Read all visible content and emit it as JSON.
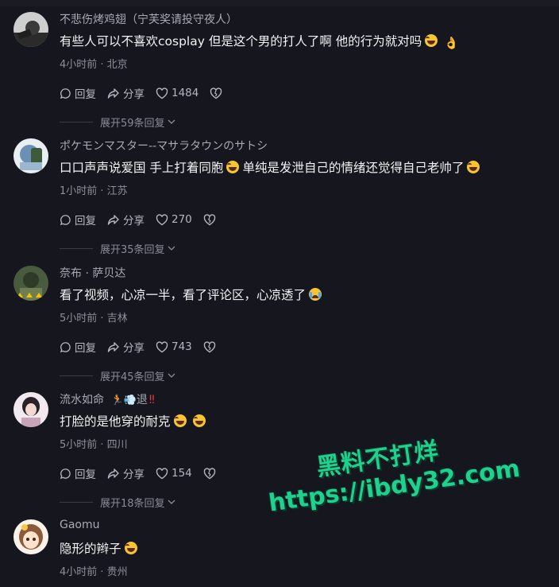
{
  "comments": [
    {
      "username": "不悲伤烤鸡翅（宁芙奖请投守夜人）",
      "text_before": "有些人可以不喜欢cosplay  但是这个男的打人了啊  他的行为就对吗",
      "time": "4小时前 · 北京",
      "reply_label": "回复",
      "share_label": "分享",
      "likes": "1484",
      "expand_label": "展开59条回复"
    },
    {
      "username": "ポケモンマスター--マサラタウンのサトシ",
      "text_before": "口口声声说爱国 手上打着同胞",
      "text_after": "单纯是发泄自己的情绪还觉得自己老帅了",
      "time": "1小时前 · 江苏",
      "reply_label": "回复",
      "share_label": "分享",
      "likes": "270",
      "expand_label": "展开35条回复"
    },
    {
      "username": "奈布 · 萨贝达",
      "text_before": "看了视频，心凉一半，看了评论区，心凉透了",
      "time": "5小时前 · 吉林",
      "reply_label": "回复",
      "share_label": "分享",
      "likes": "743",
      "expand_label": "展开45条回复"
    },
    {
      "username": "流水如命",
      "username_suffix": "退",
      "text_before": "打脸的是他穿的耐克",
      "time": "5小时前 · 四川",
      "reply_label": "回复",
      "share_label": "分享",
      "likes": "154",
      "expand_label": "展开18条回复"
    },
    {
      "username": "Gaomu",
      "text_before": "隐形的辫子",
      "time": "4小时前 · 贵州"
    }
  ],
  "watermark": {
    "line1": "黑料不打烊",
    "line2": "https://ibdy32.com"
  },
  "colors": {
    "background": "#16161e",
    "watermark": "#1fd08e"
  }
}
